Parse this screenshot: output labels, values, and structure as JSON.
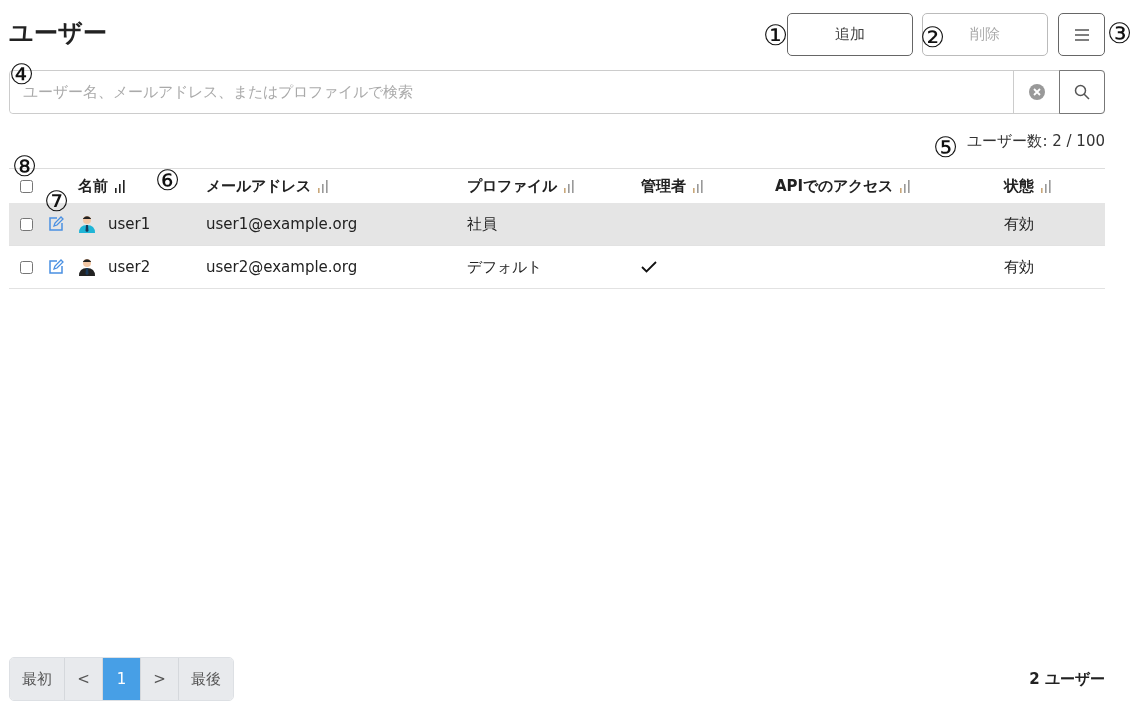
{
  "title": "ユーザー",
  "actions": [
    {
      "label": "追加",
      "disabled": false
    },
    {
      "label": "削除",
      "disabled": true
    }
  ],
  "search": {
    "placeholder": "ユーザー名、メールアドレス、またはプロファイルで検索"
  },
  "user_count": "ユーザー数: 2 / 100",
  "columns": [
    {
      "label": "名前",
      "sorted": true
    },
    {
      "label": "メールアドレス",
      "sorted": false
    },
    {
      "label": "プロファイル",
      "sorted": false
    },
    {
      "label": "管理者",
      "sorted": false
    },
    {
      "label": "APIでのアクセス",
      "sorted": false
    },
    {
      "label": "状態",
      "sorted": false
    }
  ],
  "header_checkbox": {
    "checked": false
  },
  "rows": [
    {
      "checked": false,
      "highlighted": true,
      "color": "#1fb5d6",
      "name": "user1",
      "email": "user1@example.org",
      "profile": "社員",
      "admin": false,
      "status": "有効"
    },
    {
      "checked": false,
      "highlighted": false,
      "color": "#222222",
      "name": "user2",
      "email": "user2@example.org",
      "profile": "デフォルト",
      "admin": true,
      "status": "有効"
    }
  ],
  "pagination": [
    {
      "label": "最初",
      "selected": false
    },
    {
      "label": "<",
      "selected": false
    },
    {
      "label": "1",
      "selected": true
    },
    {
      "label": ">",
      "selected": false
    },
    {
      "label": "最後",
      "selected": false
    }
  ],
  "total": "2 ユーザー",
  "callouts": [
    "①",
    "②",
    "③",
    "④",
    "⑤",
    "⑥",
    "⑦",
    "⑧"
  ]
}
